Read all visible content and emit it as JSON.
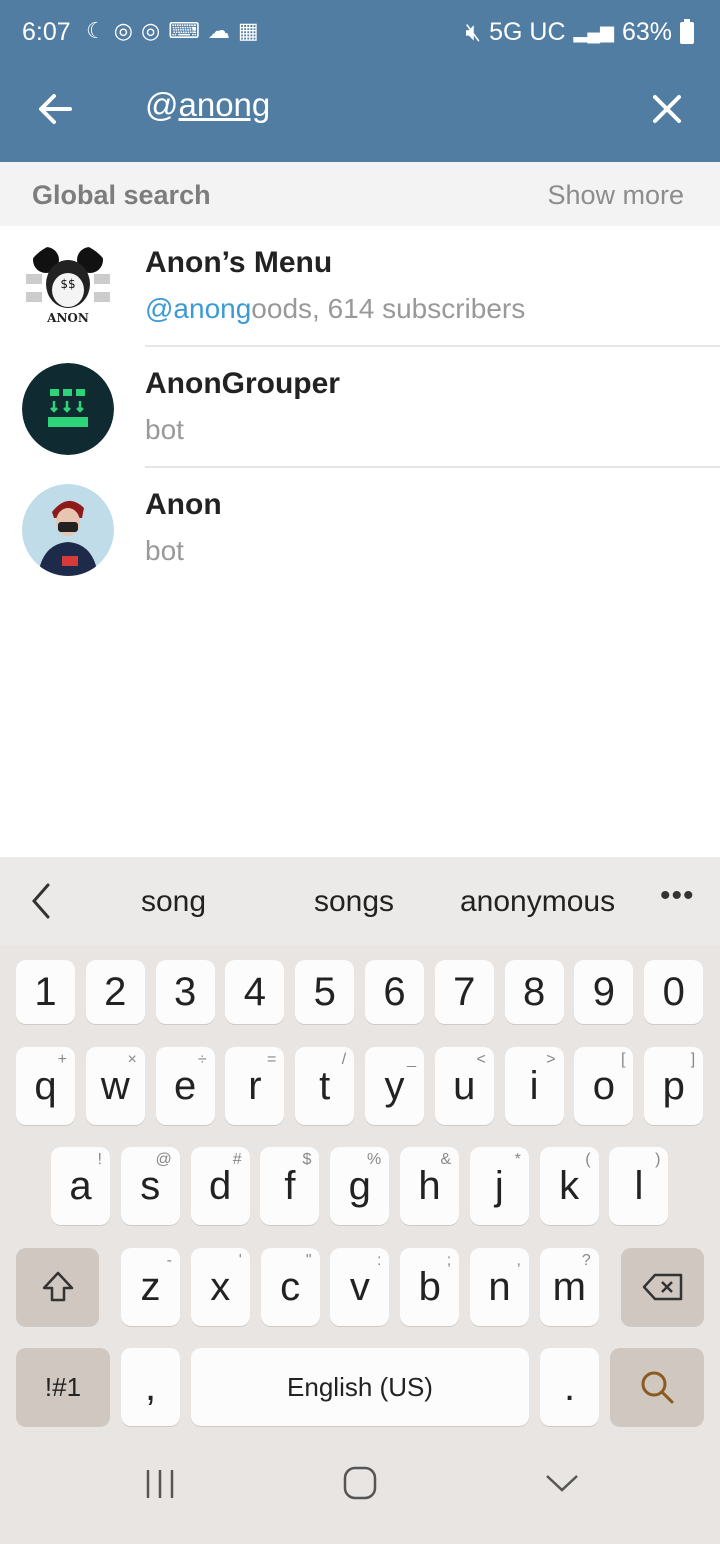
{
  "status": {
    "time": "6:07",
    "network": "5G UC",
    "battery": "63%"
  },
  "search": {
    "query_prefix": "@",
    "query_underlined": "anong"
  },
  "section": {
    "title": "Global search",
    "show_more": "Show more"
  },
  "results": [
    {
      "name": "Anon’s Menu",
      "sub_highlight": "@anong",
      "sub_rest": "oods, 614 subscribers",
      "avatar": "mickey-anon-avatar"
    },
    {
      "name": "AnonGrouper",
      "sub_highlight": "",
      "sub_rest": "bot",
      "avatar": "bot-grid-avatar"
    },
    {
      "name": "Anon",
      "sub_highlight": "",
      "sub_rest": "bot",
      "avatar": "masked-person-avatar"
    }
  ],
  "keyboard": {
    "suggestions": [
      "song",
      "songs",
      "anonymous"
    ],
    "numbers": [
      "1",
      "2",
      "3",
      "4",
      "5",
      "6",
      "7",
      "8",
      "9",
      "0"
    ],
    "row1": [
      [
        "q",
        "+"
      ],
      [
        "w",
        "×"
      ],
      [
        "e",
        "÷"
      ],
      [
        "r",
        "="
      ],
      [
        "t",
        "/"
      ],
      [
        "y",
        "_"
      ],
      [
        "u",
        "<"
      ],
      [
        "i",
        ">"
      ],
      [
        "o",
        "["
      ],
      [
        "p",
        "]"
      ]
    ],
    "row2": [
      [
        "a",
        "!"
      ],
      [
        "s",
        "@"
      ],
      [
        "d",
        "#"
      ],
      [
        "f",
        "$"
      ],
      [
        "g",
        "%"
      ],
      [
        "h",
        "&"
      ],
      [
        "j",
        "*"
      ],
      [
        "k",
        "("
      ],
      [
        "l",
        ")"
      ]
    ],
    "row3": [
      [
        "z",
        "-"
      ],
      [
        "x",
        "'"
      ],
      [
        "c",
        "\""
      ],
      [
        "v",
        ":"
      ],
      [
        "b",
        ";"
      ],
      [
        "n",
        ","
      ],
      [
        "m",
        "?"
      ]
    ],
    "symbols_label": "!#1",
    "comma": ",",
    "space_label": "English (US)",
    "period": "."
  }
}
